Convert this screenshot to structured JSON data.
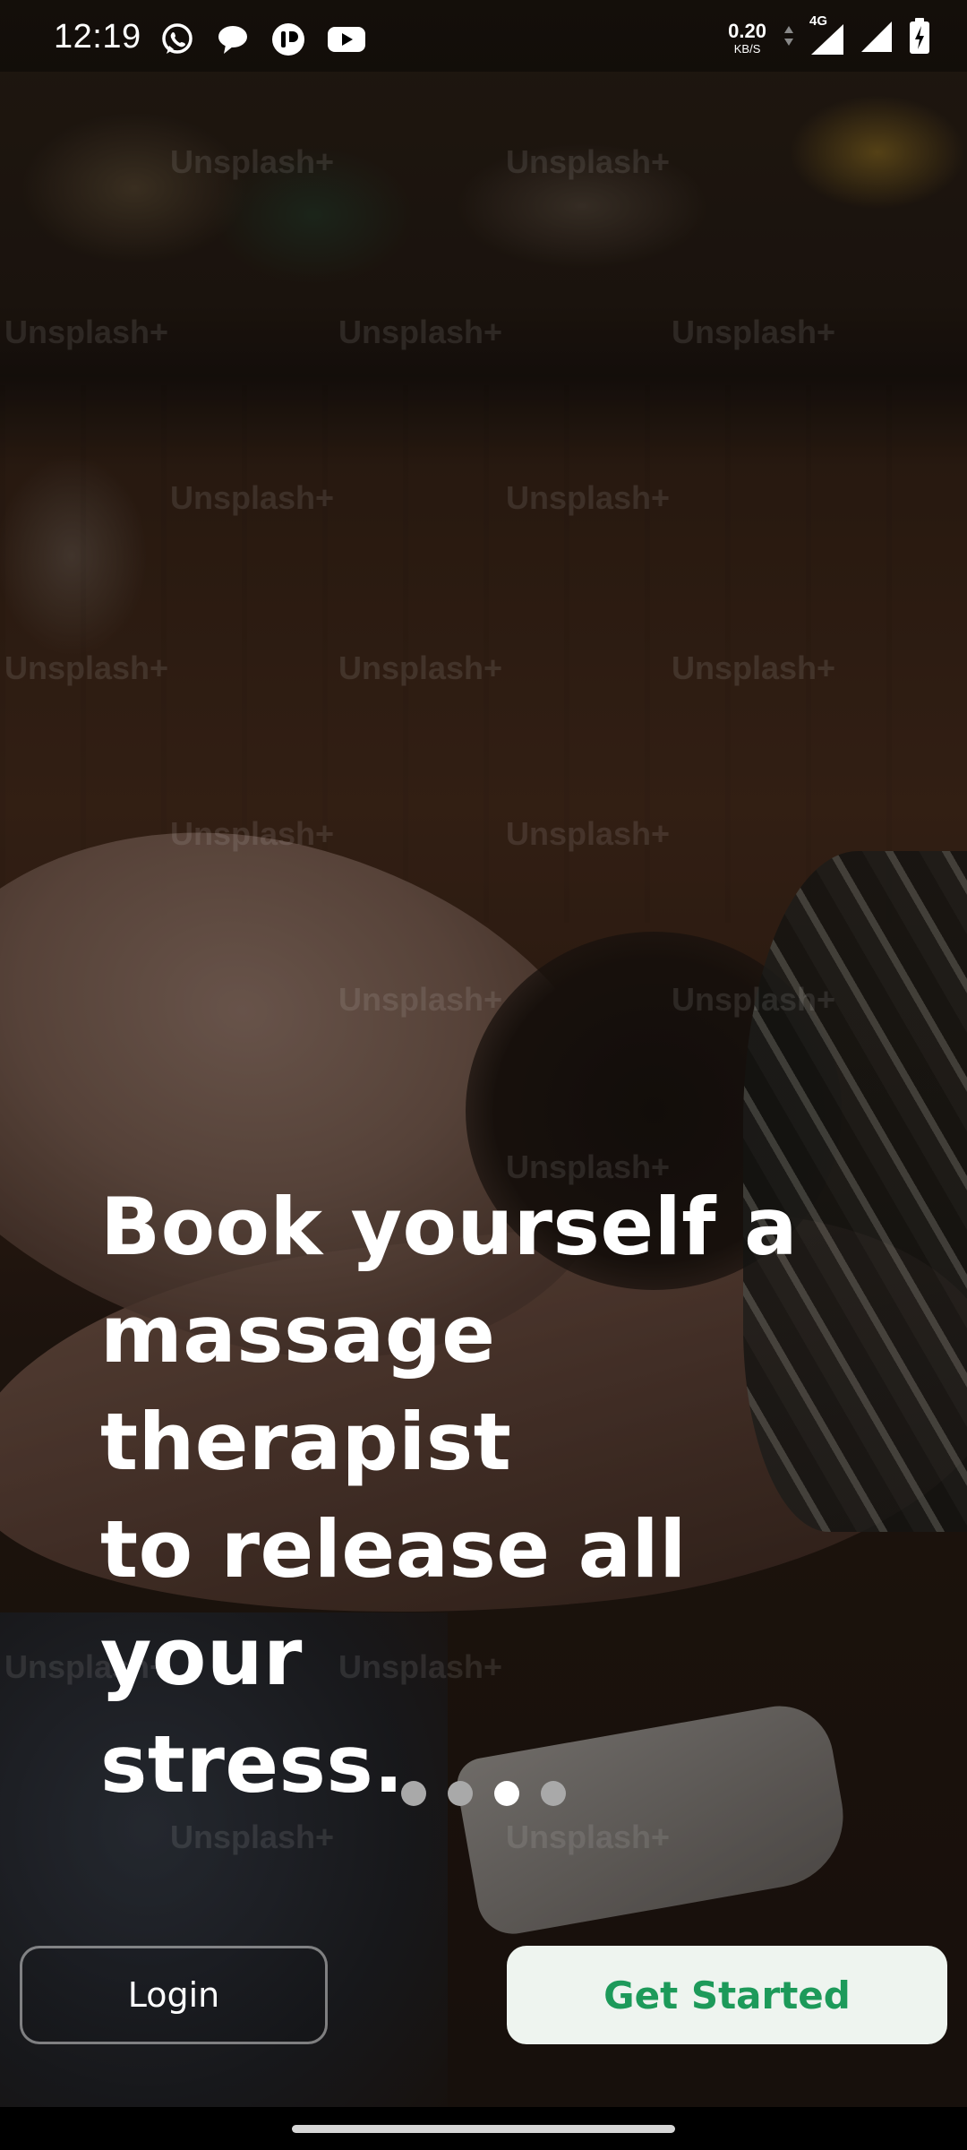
{
  "status_bar": {
    "time": "12:19",
    "net_speed_value": "0.20",
    "net_speed_unit": "KB/S",
    "network_type": "4G",
    "notification_icons": [
      "whatsapp-icon",
      "message-bubble-icon",
      "app-badge-icon",
      "youtube-icon"
    ]
  },
  "background": {
    "watermark_text": "Unsplash+"
  },
  "onboarding": {
    "headline_lines": [
      "Book yourself a",
      "massage therapist",
      "to release all your",
      "stress."
    ],
    "page_count": 4,
    "active_page_index": 2
  },
  "actions": {
    "login_label": "Login",
    "get_started_label": "Get Started"
  },
  "colors": {
    "primary_green": "#1d9a5a",
    "start_button_bg": "#eef4ef",
    "dot_active": "#ffffff",
    "dot_inactive": "#a9a9a9"
  }
}
